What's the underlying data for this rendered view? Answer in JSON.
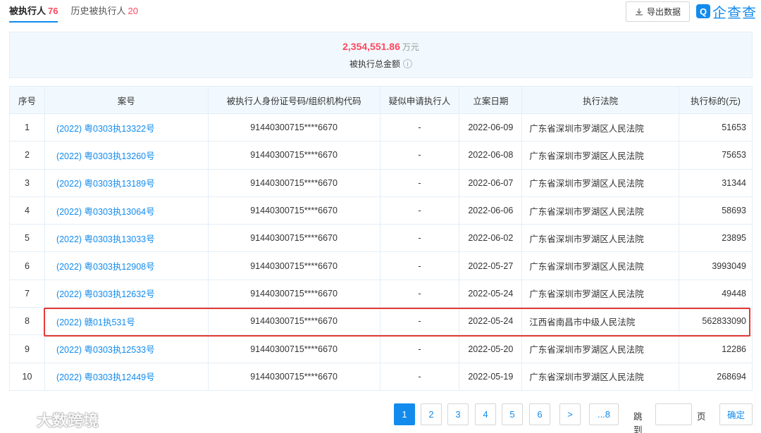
{
  "tabs": [
    {
      "label": "被执行人",
      "count": "76",
      "active": true
    },
    {
      "label": "历史被执行人",
      "count": "20",
      "active": false
    }
  ],
  "export_label": "导出数据",
  "logo": {
    "mark": "Q",
    "text": "企查查"
  },
  "summary": {
    "amount": "2,354,551.86",
    "unit": "万元",
    "label": "被执行总金额",
    "info_icon": "i"
  },
  "table": {
    "headers": [
      "序号",
      "案号",
      "被执行人身份证号码/组织机构代码",
      "疑似申请执行人",
      "立案日期",
      "执行法院",
      "执行标的(元)"
    ],
    "rows": [
      {
        "no": "1",
        "case": "(2022) 粤0303执13322号",
        "id": "91440300715****6670",
        "applicant": "-",
        "date": "2022-06-09",
        "court": "广东省深圳市罗湖区人民法院",
        "amount": "51653"
      },
      {
        "no": "2",
        "case": "(2022) 粤0303执13260号",
        "id": "91440300715****6670",
        "applicant": "-",
        "date": "2022-06-08",
        "court": "广东省深圳市罗湖区人民法院",
        "amount": "75653"
      },
      {
        "no": "3",
        "case": "(2022) 粤0303执13189号",
        "id": "91440300715****6670",
        "applicant": "-",
        "date": "2022-06-07",
        "court": "广东省深圳市罗湖区人民法院",
        "amount": "31344"
      },
      {
        "no": "4",
        "case": "(2022) 粤0303执13064号",
        "id": "91440300715****6670",
        "applicant": "-",
        "date": "2022-06-06",
        "court": "广东省深圳市罗湖区人民法院",
        "amount": "58693"
      },
      {
        "no": "5",
        "case": "(2022) 粤0303执13033号",
        "id": "91440300715****6670",
        "applicant": "-",
        "date": "2022-06-02",
        "court": "广东省深圳市罗湖区人民法院",
        "amount": "23895"
      },
      {
        "no": "6",
        "case": "(2022) 粤0303执12908号",
        "id": "91440300715****6670",
        "applicant": "-",
        "date": "2022-05-27",
        "court": "广东省深圳市罗湖区人民法院",
        "amount": "3993049"
      },
      {
        "no": "7",
        "case": "(2022) 粤0303执12632号",
        "id": "91440300715****6670",
        "applicant": "-",
        "date": "2022-05-24",
        "court": "广东省深圳市罗湖区人民法院",
        "amount": "49448"
      },
      {
        "no": "8",
        "case": "(2022) 赣01执531号",
        "id": "91440300715****6670",
        "applicant": "-",
        "date": "2022-05-24",
        "court": "江西省南昌市中级人民法院",
        "amount": "562833090"
      },
      {
        "no": "9",
        "case": "(2022) 粤0303执12533号",
        "id": "91440300715****6670",
        "applicant": "-",
        "date": "2022-05-20",
        "court": "广东省深圳市罗湖区人民法院",
        "amount": "12286"
      },
      {
        "no": "10",
        "case": "(2022) 粤0303执12449号",
        "id": "91440300715****6670",
        "applicant": "-",
        "date": "2022-05-19",
        "court": "广东省深圳市罗湖区人民法院",
        "amount": "268694"
      }
    ]
  },
  "pagination": {
    "pages": [
      "1",
      "2",
      "3",
      "4",
      "5",
      "6"
    ],
    "current": "1",
    "next": ">",
    "last": "...8",
    "jump_label": "跳到",
    "page_label": "页",
    "confirm": "确定"
  },
  "watermark": {
    "text": "大数跨境"
  },
  "colors": {
    "accent": "#128bed",
    "amount_red": "#fd485e",
    "highlight_red": "#e53935"
  }
}
